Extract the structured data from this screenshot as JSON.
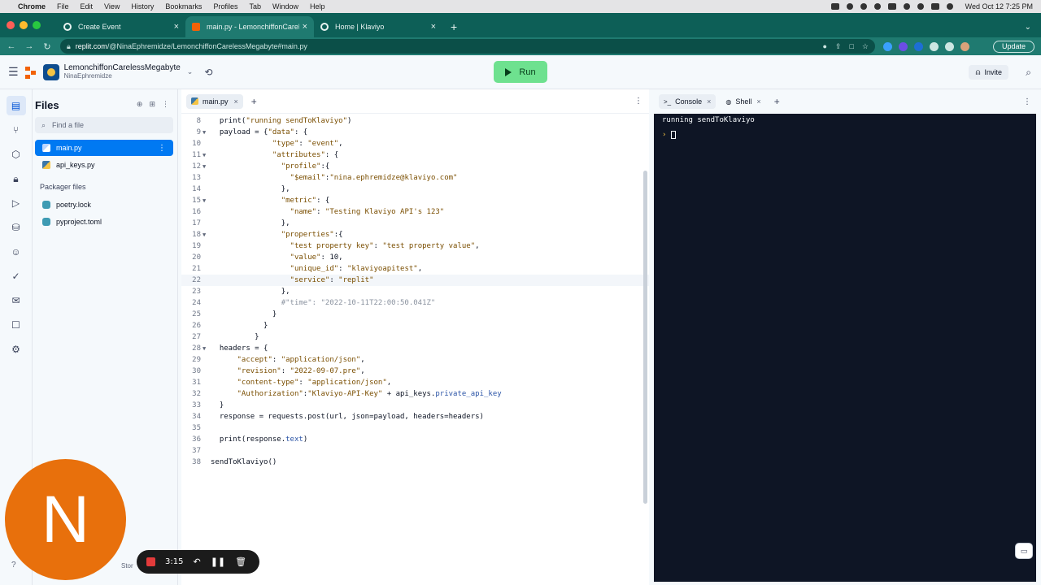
{
  "menubar": {
    "items": [
      "Chrome",
      "File",
      "Edit",
      "View",
      "History",
      "Bookmarks",
      "Profiles",
      "Tab",
      "Window",
      "Help"
    ],
    "clock": "Wed Oct 12  7:25 PM"
  },
  "browser": {
    "tabs": [
      {
        "label": "Create Event",
        "active": false
      },
      {
        "label": "main.py - LemonchiffonCarele",
        "active": true
      },
      {
        "label": "Home | Klaviyo",
        "active": false
      }
    ],
    "url_host": "replit.com",
    "url_path": "/@NinaEphremidze/LemonchiffonCarelessMegabyte#main.py",
    "update_label": "Update"
  },
  "header": {
    "repl_name": "LemonchiffonCarelessMegabyte",
    "owner": "NinaEphremidze",
    "run_label": "Run",
    "invite_label": "Invite",
    "accent": "#6ee18f"
  },
  "files": {
    "title": "Files",
    "find_placeholder": "Find a file",
    "items": [
      {
        "name": "main.py",
        "selected": true
      },
      {
        "name": "api_keys.py",
        "selected": false
      }
    ],
    "section": "Packager files",
    "packager": [
      "poetry.lock",
      "pyproject.toml"
    ]
  },
  "editor": {
    "tab_label": "main.py",
    "lines": [
      {
        "n": "8",
        "fold": "",
        "code": "  print(\"running sendToKlaviyo\")"
      },
      {
        "n": "9",
        "fold": "▼",
        "code": "  payload = {\"data\": {"
      },
      {
        "n": "10",
        "fold": "",
        "code": "              \"type\": \"event\","
      },
      {
        "n": "11",
        "fold": "▼",
        "code": "              \"attributes\": {"
      },
      {
        "n": "12",
        "fold": "▼",
        "code": "                \"profile\":{"
      },
      {
        "n": "13",
        "fold": "",
        "code": "                  \"$email\":\"nina.ephremidze@klaviyo.com\""
      },
      {
        "n": "14",
        "fold": "",
        "code": "                },"
      },
      {
        "n": "15",
        "fold": "▼",
        "code": "                \"metric\": {"
      },
      {
        "n": "16",
        "fold": "",
        "code": "                  \"name\": \"Testing Klaviyo API's 123\""
      },
      {
        "n": "17",
        "fold": "",
        "code": "                },"
      },
      {
        "n": "18",
        "fold": "▼",
        "code": "                \"properties\":{"
      },
      {
        "n": "19",
        "fold": "",
        "code": "                  \"test property key\": \"test property value\","
      },
      {
        "n": "20",
        "fold": "",
        "code": "                  \"value\": 10,"
      },
      {
        "n": "21",
        "fold": "",
        "code": "                  \"unique_id\": \"klaviyoapitest\","
      },
      {
        "n": "22",
        "fold": "",
        "code": "                  \"service\": \"replit\""
      },
      {
        "n": "23",
        "fold": "",
        "code": "                },"
      },
      {
        "n": "24",
        "fold": "",
        "code": "                #\"time\": \"2022-10-11T22:00:50.041Z\""
      },
      {
        "n": "25",
        "fold": "",
        "code": "              }"
      },
      {
        "n": "26",
        "fold": "",
        "code": "            }"
      },
      {
        "n": "27",
        "fold": "",
        "code": "          }"
      },
      {
        "n": "28",
        "fold": "▼",
        "code": "  headers = {"
      },
      {
        "n": "29",
        "fold": "",
        "code": "      \"accept\": \"application/json\","
      },
      {
        "n": "30",
        "fold": "",
        "code": "      \"revision\": \"2022-09-07.pre\","
      },
      {
        "n": "31",
        "fold": "",
        "code": "      \"content-type\": \"application/json\","
      },
      {
        "n": "32",
        "fold": "",
        "code": "      \"Authorization\":\"Klaviyo-API-Key\" + api_keys.private_api_key"
      },
      {
        "n": "33",
        "fold": "",
        "code": "  }"
      },
      {
        "n": "34",
        "fold": "",
        "code": "  response = requests.post(url, json=payload, headers=headers)"
      },
      {
        "n": "35",
        "fold": "",
        "code": ""
      },
      {
        "n": "36",
        "fold": "",
        "code": "  print(response.text)"
      },
      {
        "n": "37",
        "fold": "",
        "code": ""
      },
      {
        "n": "38",
        "fold": "",
        "code": "sendToKlaviyo()"
      }
    ],
    "current_line": "22"
  },
  "console": {
    "tab_console": "Console",
    "tab_shell": "Shell",
    "output": "running sendToKlaviyo",
    "prompt": "›"
  },
  "overlay": {
    "avatar_letter": "N",
    "rec_time": "3:15",
    "partial_label": "Stor"
  }
}
